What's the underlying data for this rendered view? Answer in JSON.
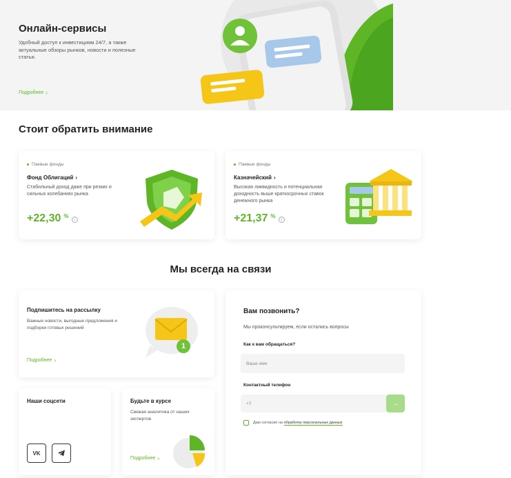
{
  "hero": {
    "title": "Онлайн-сервисы",
    "description": "Удобный доступ к инвестициям 24/7, а также актуальные обзоры рынков, новости и полезные статьи.",
    "link": "Подробнее"
  },
  "attention": {
    "title": "Стоит обратить внимание",
    "funds": [
      {
        "tag": "Паевые фонды",
        "name": "Фонд Облигаций",
        "description": "Стабильный доход даже при резких и сильных колебаниях рынка",
        "return": "+22,30",
        "unit": "%"
      },
      {
        "tag": "Паевые фонды",
        "name": "Казначейский",
        "description": "Высокая ликвидность и потенциальная доходность выше краткосрочных ставок денежного рынка",
        "return": "+21,37",
        "unit": "%"
      }
    ]
  },
  "contact": {
    "title": "Мы всегда на связи",
    "newsletter": {
      "title": "Подпишитесь на рассылку",
      "description": "Важные новости, выгодные предложения и подборки готовых решений",
      "link": "Подробнее",
      "badge": "1"
    },
    "social": {
      "title": "Наши соцсети",
      "vk": "VK"
    },
    "updates": {
      "title": "Будьте в курсе",
      "description": "Свежая аналитика от наших экспертов",
      "link": "Подробнее"
    },
    "callback": {
      "title": "Вам позвонить?",
      "subtitle": "Мы проконсультируем, если остались вопросы",
      "name_label": "Как к вам обращаться?",
      "name_placeholder": "Ваше имя",
      "phone_label": "Контактный телефон",
      "phone_value": "+7",
      "consent_text": "Даю согласие на ",
      "consent_link": "обработку персональных данных"
    }
  },
  "colors": {
    "accent": "#5eb526",
    "yellow": "#f5c518",
    "blue": "#a8c8ea"
  },
  "icons": [
    "chevron-right-icon",
    "info-icon",
    "vk-icon",
    "telegram-icon",
    "arrow-right-icon",
    "checkbox-icon"
  ]
}
